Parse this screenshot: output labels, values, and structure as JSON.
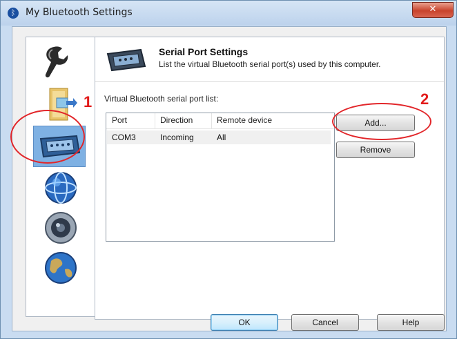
{
  "window": {
    "title": "My Bluetooth Settings",
    "close_glyph": "✕"
  },
  "sidebar": {
    "items": [
      {
        "name": "wrench-icon"
      },
      {
        "name": "folder-transfer-icon"
      },
      {
        "name": "serial-port-icon",
        "selected": true
      },
      {
        "name": "network-globe-icon"
      },
      {
        "name": "speaker-icon"
      },
      {
        "name": "earth-globe-icon"
      }
    ]
  },
  "panel": {
    "title": "Serial Port Settings",
    "subtitle": "List the virtual Bluetooth serial port(s) used by this computer.",
    "list_label": "Virtual Bluetooth serial port list:",
    "columns": [
      "Port",
      "Direction",
      "Remote device"
    ],
    "rows": [
      {
        "port": "COM3",
        "direction": "Incoming",
        "remote": "All"
      }
    ],
    "add_label": "Add...",
    "remove_label": "Remove"
  },
  "footer": {
    "ok_label": "OK",
    "cancel_label": "Cancel",
    "help_label": "Help"
  },
  "annotations": {
    "one": "1",
    "two": "2",
    "color": "#e21a1a"
  }
}
